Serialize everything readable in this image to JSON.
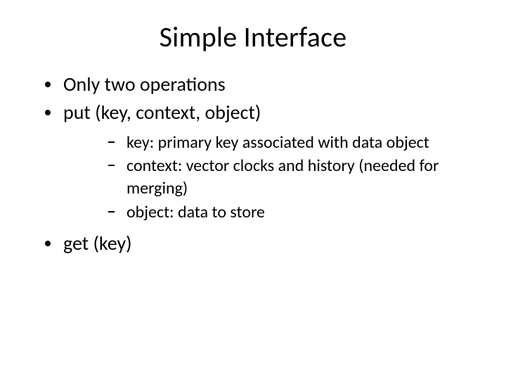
{
  "title": "Simple Interface",
  "bullets": {
    "b0": "Only two operations",
    "b1": "put (key, context, object)",
    "b1_sub": {
      "s0": "key: primary key associated with data object",
      "s1": "context: vector clocks and history (needed for merging)",
      "s2": "object: data to store"
    },
    "b2": "get (key)"
  }
}
